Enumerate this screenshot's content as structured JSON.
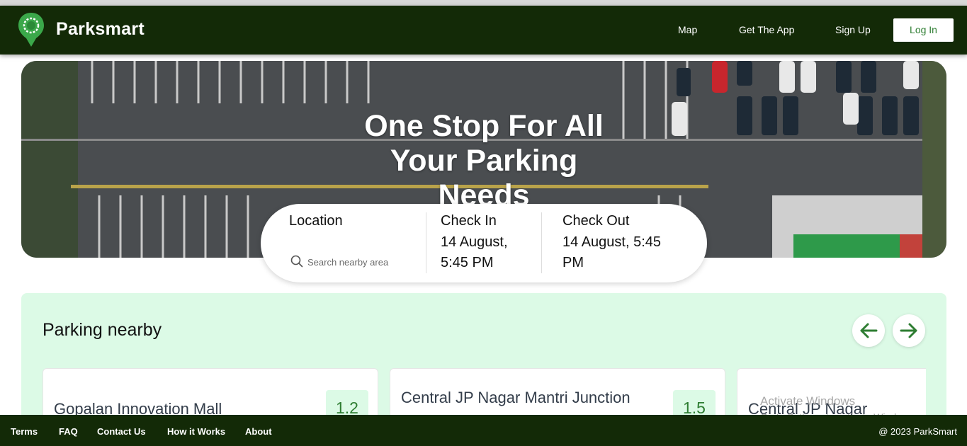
{
  "navbar": {
    "brand": "Parksmart",
    "links": [
      "Map",
      "Get The App",
      "Sign Up"
    ],
    "login_label": "Log In"
  },
  "hero": {
    "title": "One Stop For All Your Parking Needs"
  },
  "search": {
    "location_label": "Location",
    "placeholder": "Search nearby area",
    "checkin_label": "Check In",
    "checkin_value": "14 August, 5:45 PM",
    "checkout_label": "Check Out",
    "checkout_value": "14 August, 5:45 PM"
  },
  "nearby": {
    "title": "Parking nearby",
    "cards": [
      {
        "name": "Gopalan Innovation Mall",
        "distance": "1.2"
      },
      {
        "name": "Central JP Nagar Mantri Junction",
        "distance": "1.5"
      },
      {
        "name": "Central JP Nagar",
        "distance": ""
      }
    ]
  },
  "watermark": {
    "line1": "Activate Windows",
    "line2": "Go to Settings to activate Windows."
  },
  "footer": {
    "links": [
      "Terms",
      "FAQ",
      "Contact Us",
      "How it Works",
      "About"
    ],
    "copyright": "@ 2023 ParkSmart"
  },
  "colors": {
    "nav_bg": "#132a07",
    "accent_green": "#2e7d32",
    "nearby_bg": "#dcfae6"
  },
  "icons": [
    "map-pin-logo-icon",
    "search-icon",
    "arrow-left-icon",
    "arrow-right-icon"
  ]
}
